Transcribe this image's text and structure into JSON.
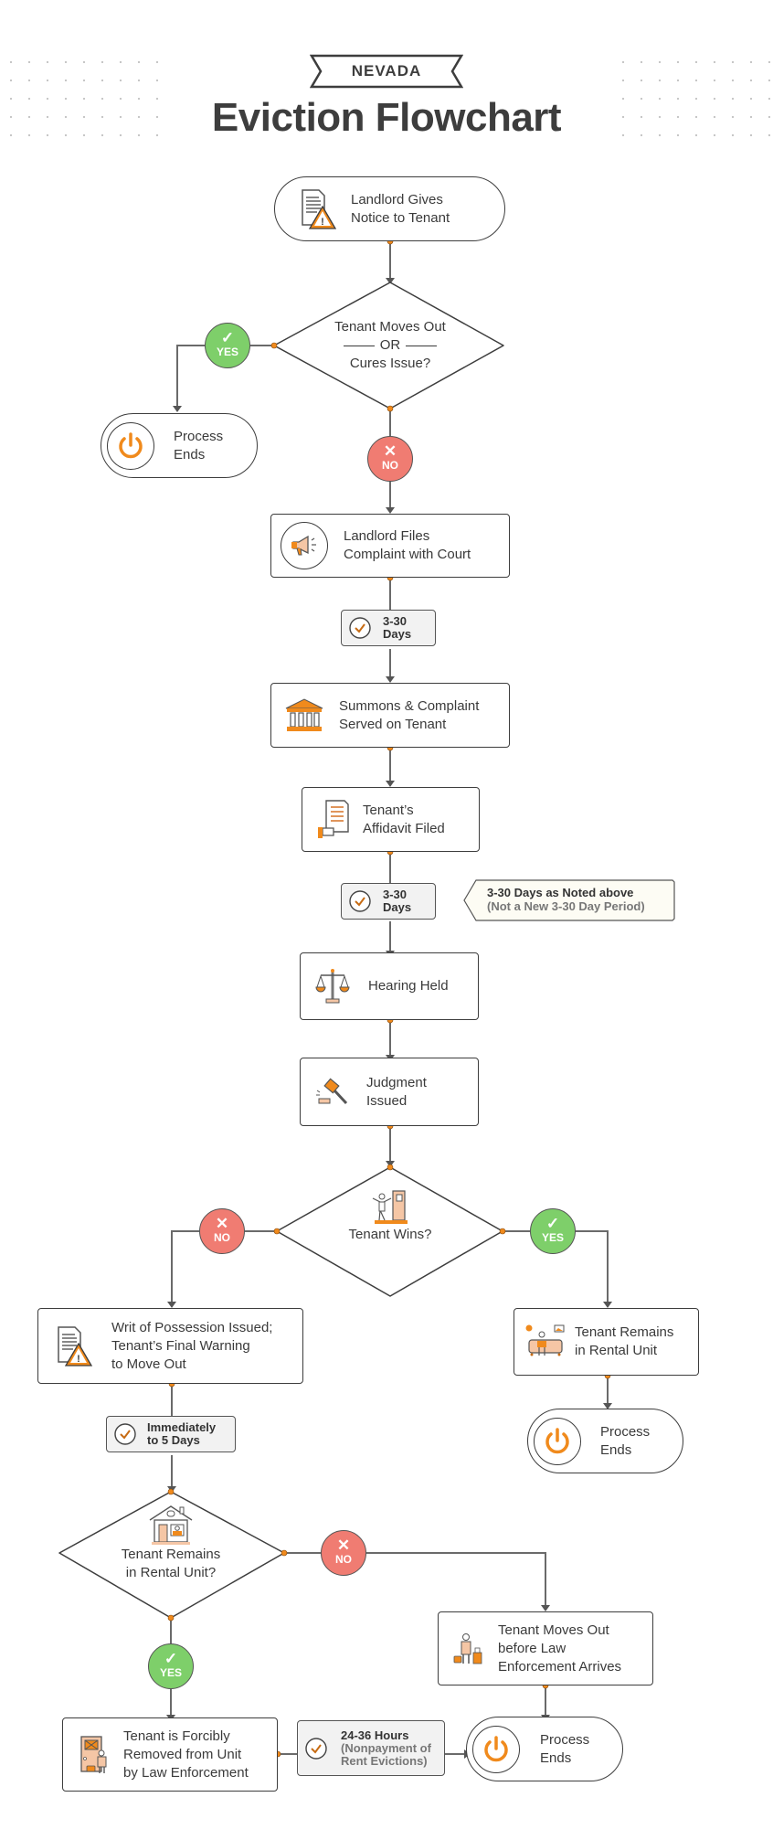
{
  "header": {
    "state_label": "NEVADA",
    "title": "Eviction Flowchart"
  },
  "colors": {
    "accent_orange": "#f08a1c",
    "yes_green": "#7ecf6a",
    "no_red": "#f07c72",
    "line_gray": "#555555",
    "text_dark": "#3a3a3a"
  },
  "nodes": {
    "notice": {
      "lines": [
        "Landlord Gives",
        "Notice to Tenant"
      ],
      "icon": "document-warning-icon"
    },
    "decision1": {
      "line1": "Tenant Moves Out",
      "or": "OR",
      "line2": "Cures Issue?"
    },
    "end1": {
      "lines": [
        "Process",
        "Ends"
      ],
      "icon": "power-icon"
    },
    "complaint": {
      "lines": [
        "Landlord Files",
        "Complaint with Court"
      ],
      "icon": "megaphone-icon"
    },
    "timer1": {
      "line1": "3-30",
      "line2": "Days",
      "icon": "clock-icon"
    },
    "summons": {
      "lines": [
        "Summons & Complaint",
        "Served on Tenant"
      ],
      "icon": "courthouse-icon"
    },
    "affidavit": {
      "lines": [
        "Tenant’s",
        "Affidavit Filed"
      ],
      "icon": "signed-document-icon"
    },
    "timer2": {
      "line1": "3-30",
      "line2": "Days",
      "icon": "clock-icon"
    },
    "note2": {
      "line1": "3-30 Days as Noted above",
      "line2": "(Not a New 3-30 Day Period)"
    },
    "hearing": {
      "lines": [
        "Hearing Held"
      ],
      "icon": "scales-icon"
    },
    "judgment": {
      "lines": [
        "Judgment",
        "Issued"
      ],
      "icon": "gavel-icon"
    },
    "decision2": {
      "text": "Tenant Wins?",
      "icon": "tenant-door-icon"
    },
    "writ": {
      "lines": [
        "Writ of Possession Issued;",
        "Tenant’s Final Warning",
        "to Move Out"
      ],
      "icon": "document-warning-icon"
    },
    "remains": {
      "lines": [
        "Tenant Remains",
        "in Rental Unit"
      ],
      "icon": "sofa-tenant-icon"
    },
    "end2": {
      "lines": [
        "Process",
        "Ends"
      ],
      "icon": "power-icon"
    },
    "timer3": {
      "line1": "Immediately",
      "line2": "to 5 Days",
      "icon": "clock-icon"
    },
    "decision3": {
      "line1": "Tenant Remains",
      "line2": "in Rental Unit?",
      "icon": "house-icon"
    },
    "movesout": {
      "lines": [
        "Tenant Moves Out",
        "before Law",
        "Enforcement Arrives"
      ],
      "icon": "luggage-person-icon"
    },
    "removed": {
      "lines": [
        "Tenant is Forcibly",
        "Removed from Unit",
        "by Law Enforcement"
      ],
      "icon": "door-officer-icon"
    },
    "timer4": {
      "line1": "24-36 Hours",
      "line2": "(Nonpayment of",
      "line3": "Rent Evictions)",
      "icon": "clock-icon"
    },
    "end3": {
      "lines": [
        "Process",
        "Ends"
      ],
      "icon": "power-icon"
    }
  },
  "branches": {
    "yes_label": "YES",
    "no_label": "NO",
    "yes_mark": "✓",
    "no_mark": "✕"
  }
}
